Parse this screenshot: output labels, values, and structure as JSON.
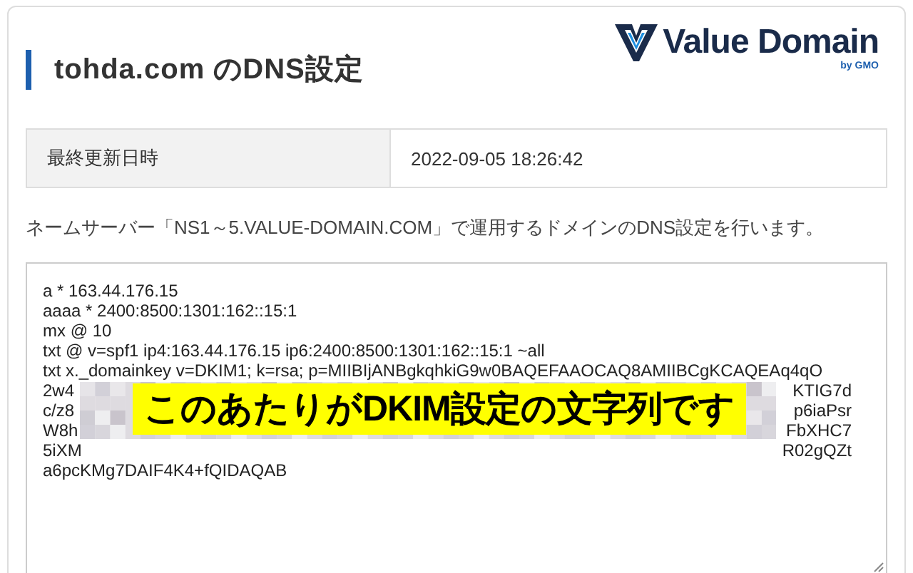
{
  "header": {
    "title": "tohda.com のDNS設定",
    "logo": {
      "name": "Value Domain",
      "byline": "by GMO"
    }
  },
  "info_table": [
    {
      "label": "最終更新日時",
      "value": "2022-09-05 18:26:42"
    }
  ],
  "description": "ネームサーバー「NS1～5.VALUE-DOMAIN.COM」で運用するドメインのDNS設定を行います。",
  "records": [
    {
      "kind": "plain",
      "text": "a * 163.44.176.15"
    },
    {
      "kind": "plain",
      "text": "aaaa * 2400:8500:1301:162::15:1"
    },
    {
      "kind": "plain",
      "text": "mx @ 10"
    },
    {
      "kind": "plain",
      "text": "txt @ v=spf1 ip4:163.44.176.15 ip6:2400:8500:1301:162::15:1 ~all"
    },
    {
      "kind": "plain",
      "text": "txt x._domainkey v=DKIM1; k=rsa; p=MIIBIjANBgkqhkiG9w0BAQEFAAOCAQ8AMIIBCgKCAQEAq4qO"
    },
    {
      "kind": "masked",
      "start": "2w4",
      "end": "KTIG7d"
    },
    {
      "kind": "masked",
      "start": "c/z8",
      "end": "p6iaPsr"
    },
    {
      "kind": "masked",
      "start": "W8h",
      "end": "FbXHC7"
    },
    {
      "kind": "masked",
      "start": "5iXM",
      "end": "R02gQZt"
    },
    {
      "kind": "plain",
      "text": "a6pcKMg7DAIF4K4+fQIDAQAB"
    }
  ],
  "annotation": "このあたりがDKIM設定の文字列です"
}
